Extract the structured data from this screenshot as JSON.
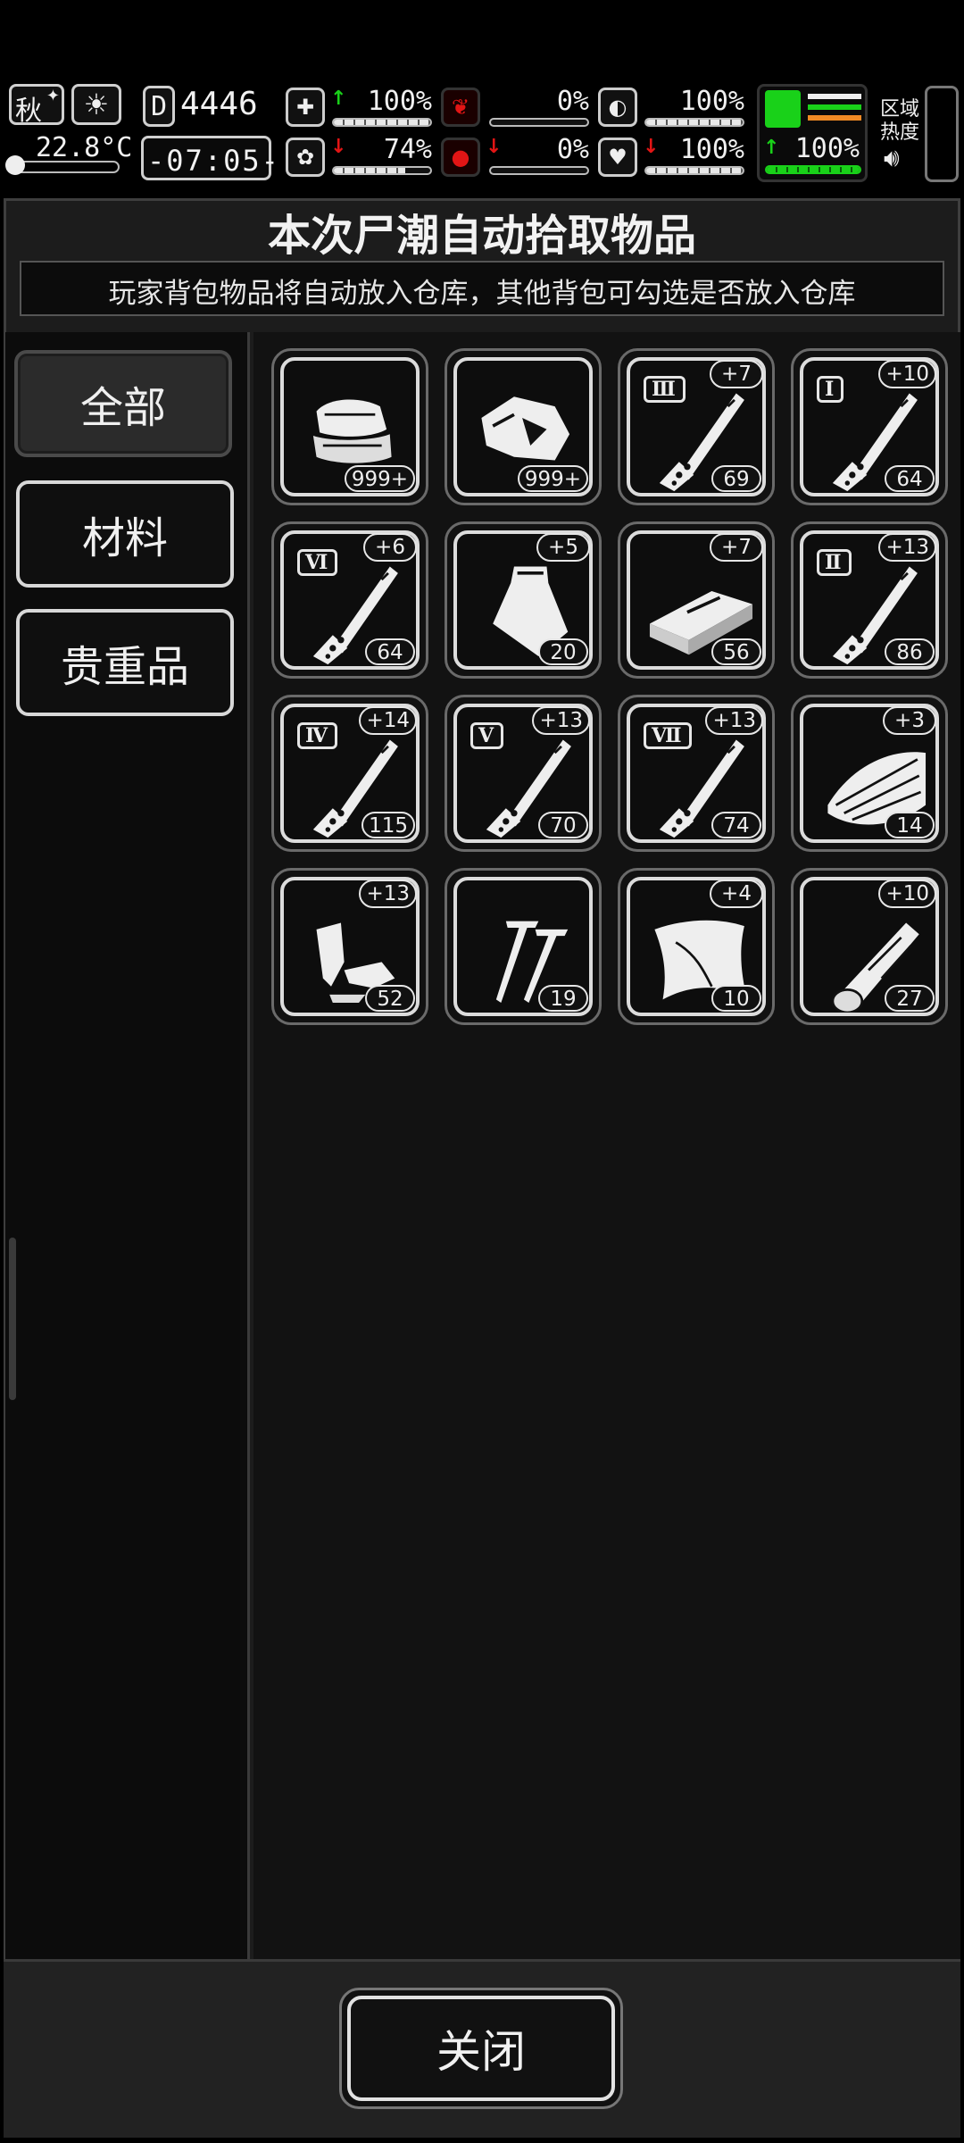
{
  "hud": {
    "season": "秋",
    "temperature": "22.8°C",
    "day_counter": "4446",
    "time": "-07:05-",
    "region_heat_label_1": "区域",
    "region_heat_label_2": "热度",
    "stats": {
      "health": {
        "value": "100%",
        "trend": "up",
        "level": 1.0
      },
      "stomach": {
        "value": "0%",
        "level": 0.0
      },
      "pill": {
        "value": "100%",
        "level": 1.0
      },
      "stamina": {
        "value": "100%",
        "trend": "up",
        "level": 1.0
      },
      "sanity": {
        "value": "74%",
        "trend": "down",
        "level": 0.74
      },
      "blood": {
        "value": "0%",
        "trend": "down",
        "level": 0.0
      },
      "heart": {
        "value": "100%",
        "trend": "down",
        "level": 1.0
      }
    },
    "colors": {
      "up": "#19d119",
      "down": "#e21515",
      "accent_orange": "#f08a24"
    }
  },
  "dialog": {
    "title": "本次尸潮自动拾取物品",
    "subtitle": "玩家背包物品将自动放入仓库，其他背包可勾选是否放入仓库",
    "close_label": "关闭"
  },
  "tabs": [
    {
      "label": "全部",
      "active": true
    },
    {
      "label": "材料",
      "active": false
    },
    {
      "label": "贵重品",
      "active": false
    }
  ],
  "items": [
    {
      "icon": "cloth-icon",
      "qty": "999+",
      "bonus": "",
      "tier": ""
    },
    {
      "icon": "meat-icon",
      "qty": "999+",
      "bonus": "",
      "tier": ""
    },
    {
      "icon": "syringe-icon",
      "qty": "69",
      "bonus": "+7",
      "tier": "Ⅲ"
    },
    {
      "icon": "syringe-icon",
      "qty": "64",
      "bonus": "+10",
      "tier": "Ⅰ"
    },
    {
      "icon": "syringe-icon",
      "qty": "64",
      "bonus": "+6",
      "tier": "Ⅵ"
    },
    {
      "icon": "plastic-bag-icon",
      "qty": "20",
      "bonus": "+5",
      "tier": ""
    },
    {
      "icon": "brick-icon",
      "qty": "56",
      "bonus": "+7",
      "tier": ""
    },
    {
      "icon": "syringe-icon",
      "qty": "86",
      "bonus": "+13",
      "tier": "Ⅱ"
    },
    {
      "icon": "syringe-icon",
      "qty": "115",
      "bonus": "+14",
      "tier": "Ⅳ"
    },
    {
      "icon": "syringe-icon",
      "qty": "70",
      "bonus": "+13",
      "tier": "Ⅴ"
    },
    {
      "icon": "syringe-icon",
      "qty": "74",
      "bonus": "+13",
      "tier": "Ⅶ"
    },
    {
      "icon": "bark-icon",
      "qty": "14",
      "bonus": "+3",
      "tier": ""
    },
    {
      "icon": "scrap-cloth-icon",
      "qty": "52",
      "bonus": "+13",
      "tier": ""
    },
    {
      "icon": "nails-icon",
      "qty": "19",
      "bonus": "",
      "tier": ""
    },
    {
      "icon": "leather-icon",
      "qty": "10",
      "bonus": "+4",
      "tier": ""
    },
    {
      "icon": "wood-log-icon",
      "qty": "27",
      "bonus": "+10",
      "tier": ""
    }
  ]
}
